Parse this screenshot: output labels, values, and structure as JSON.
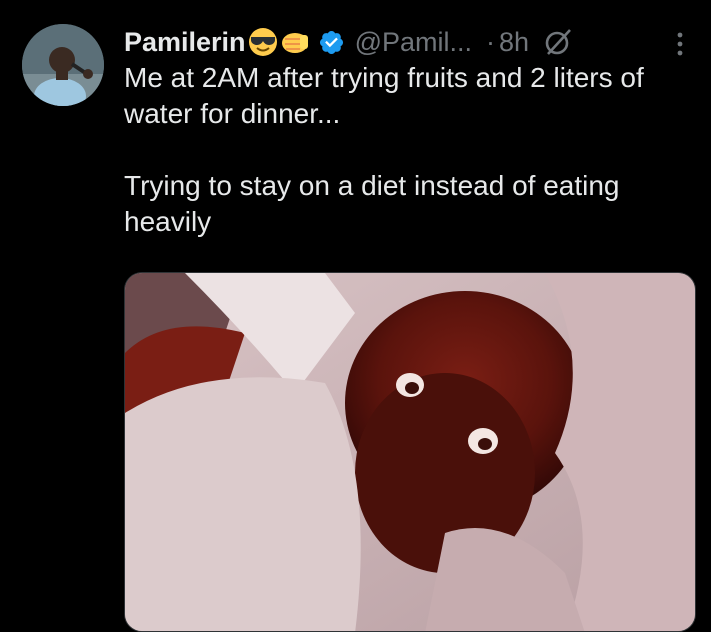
{
  "tweet": {
    "display_name": "Pamilerin",
    "emojis": [
      "smiling-face-with-sunglasses-emoji",
      "left-facing-fist-emoji"
    ],
    "verified_icon": "verified-badge-icon",
    "handle": "@Pamil...",
    "separator": "·",
    "time": "8h",
    "grok_icon": "grok-icon",
    "more_icon": "more-vertical-icon",
    "text": "Me at 2AM after trying fruits and 2 liters of water for dinner...\n\nTrying to stay on a diet instead of eating heavily",
    "media": "meme-image"
  },
  "colors": {
    "background": "#000000",
    "text": "#e7e9ea",
    "muted": "#71767b",
    "verified": "#1d9bf0"
  }
}
